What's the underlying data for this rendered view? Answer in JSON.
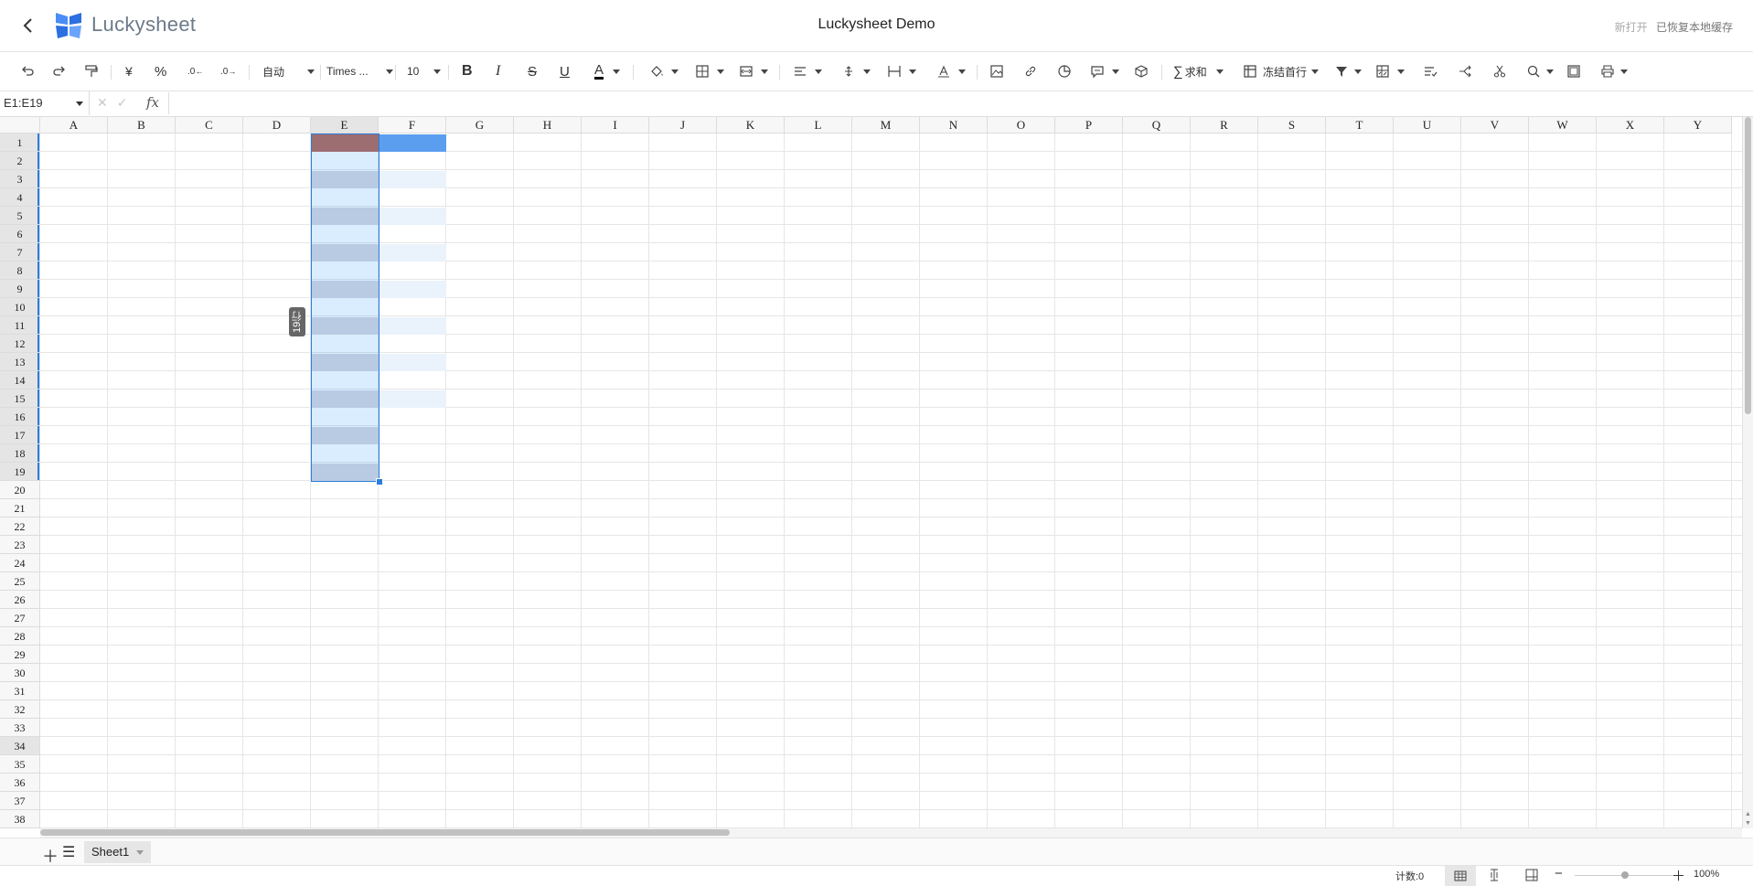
{
  "header": {
    "logo_text": "Luckysheet",
    "title": "Luckysheet Demo",
    "right_new": "新打开",
    "right_restore": "已恢复本地缓存"
  },
  "toolbar": {
    "currency": "¥",
    "percent": "%",
    "dec_inc": ".0",
    "dec_dec": ".0",
    "format_auto": "自动",
    "font": "Times ...",
    "font_size": "10",
    "bold": "B",
    "italic": "I",
    "strike": "S",
    "underline": "U",
    "text_color_letter": "A",
    "sum": "求和",
    "freeze": "冻结首行"
  },
  "formula_bar": {
    "namebox": "E1:E19",
    "fx": "fx",
    "cancel": "✕",
    "confirm": "✓",
    "value": ""
  },
  "sheet": {
    "columns": [
      "A",
      "B",
      "C",
      "D",
      "E",
      "F",
      "G",
      "H",
      "I",
      "J",
      "K",
      "L",
      "M",
      "N",
      "O",
      "P",
      "Q",
      "R",
      "S",
      "T",
      "U",
      "V",
      "W",
      "X",
      "Y"
    ],
    "rows": [
      "1",
      "2",
      "3",
      "4",
      "5",
      "6",
      "7",
      "8",
      "9",
      "10",
      "11",
      "12",
      "13",
      "14",
      "15",
      "16",
      "17",
      "18",
      "19",
      "20",
      "21",
      "22",
      "23",
      "24",
      "25",
      "26",
      "27",
      "28",
      "29",
      "30",
      "31",
      "32",
      "33",
      "34",
      "35",
      "36",
      "37",
      "38"
    ],
    "selection": "E1:E19",
    "row_count_tip": "19行",
    "colors": {
      "e1_fill": "#b8695a",
      "f1_fill": "#5b9ef0",
      "e_stripe": "#d9d8e0",
      "f_stripe": "#eaf2fc",
      "selection_border": "#2a7de0"
    }
  },
  "sheets": [
    {
      "name": "Sheet1"
    }
  ],
  "status": {
    "count": "计数:0",
    "zoom": "100%",
    "zoom_level": 1.0
  }
}
